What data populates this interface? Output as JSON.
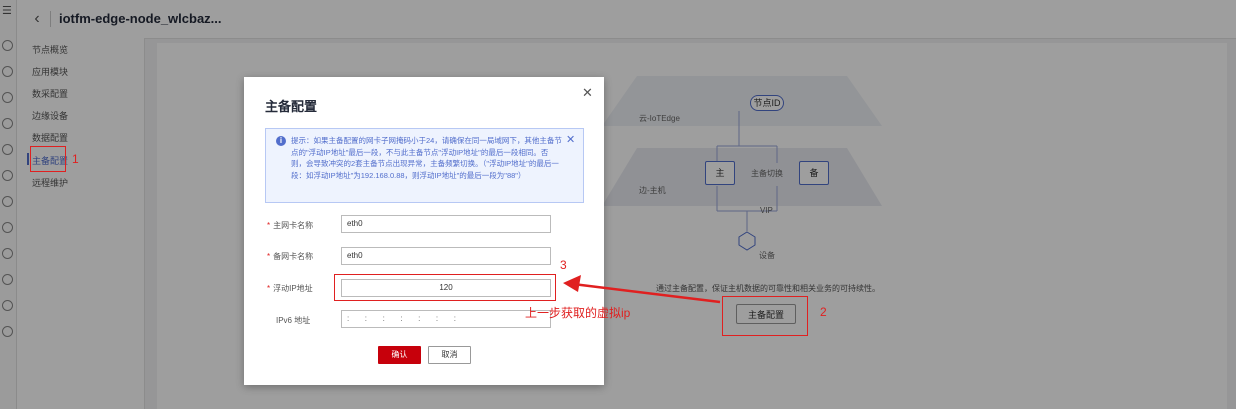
{
  "header": {
    "title": "iotfm-edge-node_wlcbaz...",
    "back_icon": "chevron-left-icon"
  },
  "nav": {
    "items": [
      "节点概览",
      "应用模块",
      "数采配置",
      "边缘设备",
      "数据配置",
      "主备配置",
      "远程维护"
    ],
    "active": "主备配置"
  },
  "diagram": {
    "cloud_layer": "云-IoTEdge",
    "edge_layer": "边-主机",
    "node_id": "节点ID",
    "primary": "主",
    "standby": "备",
    "switch": "主备切换",
    "vip": "VIP",
    "device": "设备"
  },
  "main": {
    "description": "通过主备配置，保证主机数据的可靠性和相关业务的可持续性。",
    "button": "主备配置"
  },
  "modal": {
    "title": "主备配置",
    "alert": "提示：如果主备配置的网卡子网掩码小于24，请确保在同一局域网下，其他主备节点的\"浮动IP地址\"最后一段，不与此主备节点\"浮动IP地址\"的最后一段相同。否则，会导致冲突的2套主备节点出现异常，主备频繁切换。（\"浮动IP地址\"的最后一段：如浮动IP地址\"为192.168.0.88，则浮动IP地址\"的最后一段为\"88\"）",
    "fields": {
      "primary_nic_label": "主网卡名称",
      "primary_nic_value": "eth0",
      "standby_nic_label": "备网卡名称",
      "standby_nic_value": "eth0",
      "float_ip_label": "浮动IP地址",
      "float_ip_value": "120",
      "ipv6_label": "IPv6 地址",
      "ipv6_value": ":       :       :       :       :       :       :"
    },
    "ok": "确认",
    "cancel": "取消"
  },
  "annotations": {
    "n1": "1",
    "n2": "2",
    "n3": "3",
    "arrow_text": "上一步获取的虚拟ip",
    "color": "#e02020"
  }
}
